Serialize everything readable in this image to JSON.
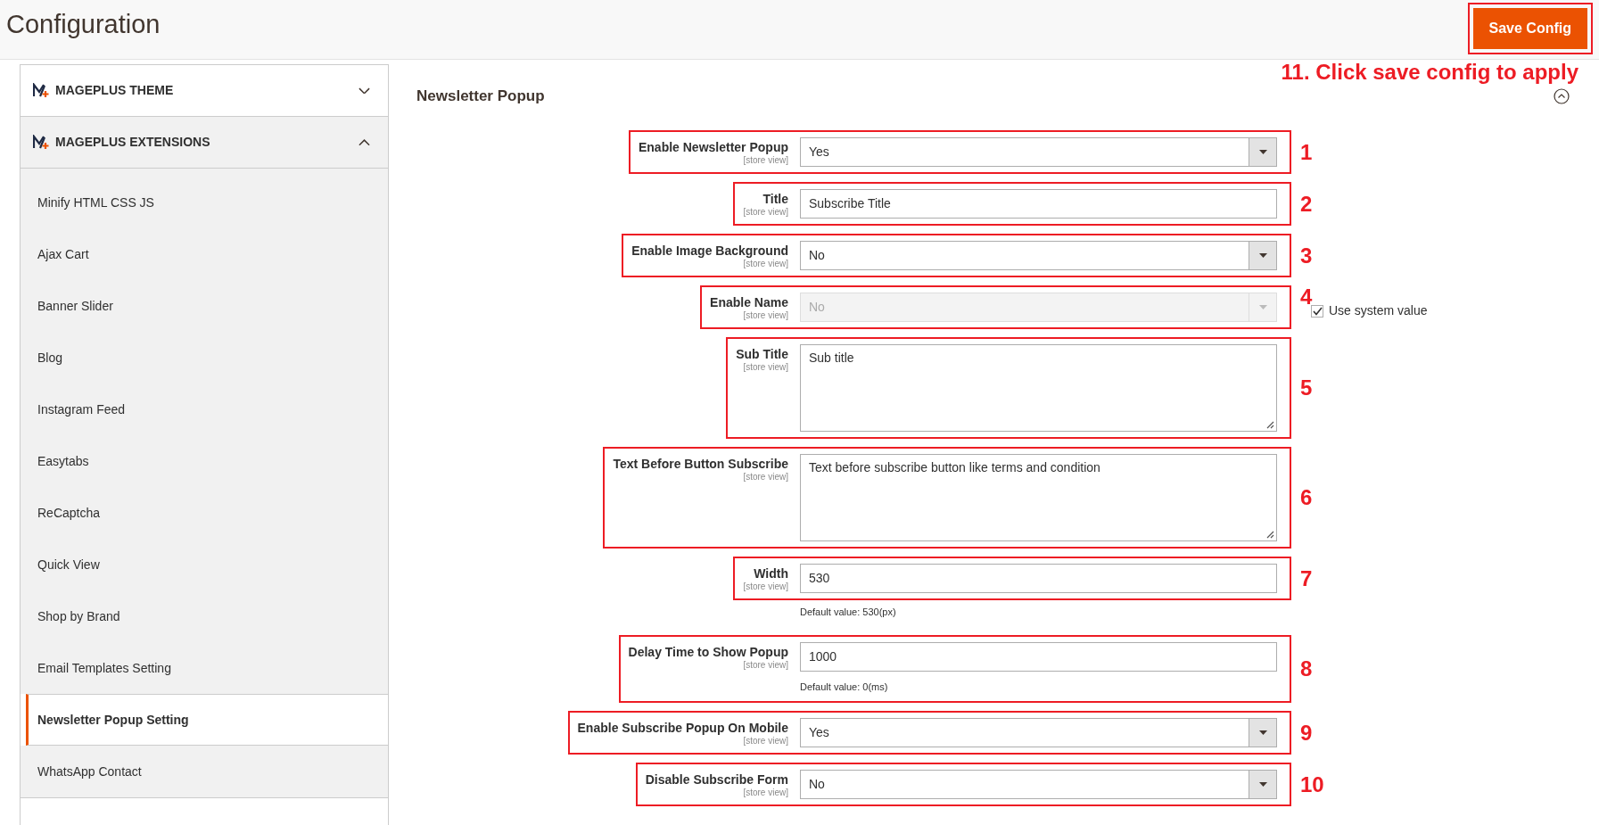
{
  "page_title": "Configuration",
  "save_button": {
    "label": "Save Config",
    "annotated": true
  },
  "save_note": "11. Click save config to apply",
  "sidebar": {
    "sections": [
      {
        "title": "MAGEPLUS THEME",
        "expanded": false
      },
      {
        "title": "MAGEPLUS EXTENSIONS",
        "expanded": true,
        "items": [
          {
            "label": "Minify HTML CSS JS",
            "selected": false
          },
          {
            "label": "Ajax Cart",
            "selected": false
          },
          {
            "label": "Banner Slider",
            "selected": false
          },
          {
            "label": "Blog",
            "selected": false
          },
          {
            "label": "Instagram Feed",
            "selected": false
          },
          {
            "label": "Easytabs",
            "selected": false
          },
          {
            "label": "ReCaptcha",
            "selected": false
          },
          {
            "label": "Quick View",
            "selected": false
          },
          {
            "label": "Shop by Brand",
            "selected": false
          },
          {
            "label": "Email Templates Setting",
            "selected": false
          },
          {
            "label": "Newsletter Popup Setting",
            "selected": true
          },
          {
            "label": "WhatsApp Contact",
            "selected": false
          }
        ]
      }
    ]
  },
  "form": {
    "title": "Newsletter Popup",
    "expanded": true,
    "fields": [
      {
        "kind": "select",
        "label": "Enable Newsletter Popup",
        "scope": "[store view]",
        "value": "Yes",
        "disabled": false,
        "annotation": "1"
      },
      {
        "kind": "text",
        "label": "Title",
        "scope": "[store view]",
        "value": "Subscribe Title",
        "annotation": "2"
      },
      {
        "kind": "select",
        "label": "Enable Image Background",
        "scope": "[store view]",
        "value": "No",
        "disabled": false,
        "annotation": "3"
      },
      {
        "kind": "select",
        "label": "Enable Name",
        "scope": "[store view]",
        "value": "No",
        "disabled": true,
        "annotation": "4",
        "use_system_value": {
          "label": "Use system value",
          "checked": true
        }
      },
      {
        "kind": "textarea",
        "label": "Sub Title",
        "scope": "[store view]",
        "value": "Sub title",
        "annotation": "5"
      },
      {
        "kind": "textarea",
        "label": "Text Before Button Subscribe",
        "scope": "[store view]",
        "value": "Text before subscribe button like terms and condition",
        "annotation": "6"
      },
      {
        "kind": "text",
        "label": "Width",
        "scope": "[store view]",
        "value": "530",
        "annotation": "7",
        "help": "Default value: 530(px)",
        "help_in_annotation": false
      },
      {
        "kind": "text",
        "label": "Delay Time to Show Popup",
        "scope": "[store view]",
        "value": "1000",
        "annotation": "8",
        "help": "Default value: 0(ms)",
        "help_in_annotation": true
      },
      {
        "kind": "select",
        "label": "Enable Subscribe Popup On Mobile",
        "scope": "[store view]",
        "value": "Yes",
        "disabled": false,
        "annotation": "9"
      },
      {
        "kind": "select",
        "label": "Disable Subscribe Form",
        "scope": "[store view]",
        "value": "No",
        "disabled": false,
        "annotation": "10"
      }
    ]
  }
}
